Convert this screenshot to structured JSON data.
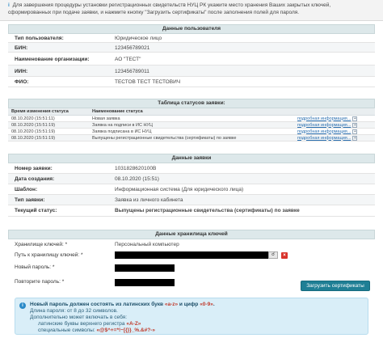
{
  "instruction": "Для завершения процедуры установки регистрационных свидетельств НУЦ РК укажите место хранения Ваших закрытых ключей, сформированных при подаче заявки, и нажмите кнопку \"Загрузить сертификаты\" после заполнения полей для пароля.",
  "user_data": {
    "header": "Данные пользователя",
    "rows": [
      {
        "label": "Тип пользователя:",
        "value": "Юридическое лицо"
      },
      {
        "label": "БИН:",
        "value": "123456789021"
      },
      {
        "label": "Наименование организации:",
        "value": "АО \"ТЕСТ\""
      },
      {
        "label": "ИИН:",
        "value": "123456789011"
      },
      {
        "label": "ФИО:",
        "value": "ТЕСТОВ ТЕСТ ТЕСТОВИЧ"
      }
    ]
  },
  "status_table": {
    "header": "Таблица статусов заявки:",
    "columns": [
      "Время изменения статуса",
      "Наименование статуса",
      ""
    ],
    "rows": [
      {
        "time": "08.10.2020 (15:51:11)",
        "status": "Новая заявка",
        "link": "подробная информация..."
      },
      {
        "time": "08.10.2020 (15:51:19)",
        "status": "Заявка на подписи в ИС НУЦ",
        "link": "подробная информация..."
      },
      {
        "time": "08.10.2020 (15:51:19)",
        "status": "Заявка подписана в ИС НУЦ",
        "link": "подробная информация..."
      },
      {
        "time": "08.10.2020 (15:51:19)",
        "status": "Выпущены регистрационные свидетельства (сертификаты) по заявке",
        "link": "подробная информация..."
      }
    ]
  },
  "request_data": {
    "header": "Данные заявки",
    "rows": [
      {
        "label": "Номер заявки:",
        "value": "1031828620100В"
      },
      {
        "label": "Дата создания:",
        "value": "08.10.2020 (15:51)"
      },
      {
        "label": "Шаблон:",
        "value": "Информационная система (Для юридического лица)"
      },
      {
        "label": "Тип заявки:",
        "value": "Заявка из личного кабинета"
      },
      {
        "label": "Текущий статус:",
        "value": "Выпущены регистрационные свидетельства (сертификаты) по заявке"
      }
    ]
  },
  "key_storage": {
    "header": "Данные хранилища ключей",
    "storage_label": "Хранилище ключей: *",
    "storage_value": "Персональный компьютер",
    "path_label": "Путь к хранилищу ключей: *",
    "new_password_label": "Новый пароль: *",
    "repeat_password_label": "Повторите пароль: *",
    "load_button": "Загрузить сертификаты",
    "search_icon": "search-icon",
    "clear_icon": "close-icon"
  },
  "info": {
    "line1_prefix": "Новый пароль должен состоять из латинских букв ",
    "line1_range1": "«a-z»",
    "line1_mid": " и цифр ",
    "line1_range2": "«0-9»",
    "line1_suffix": ".",
    "line2": "Длина пароля: от 8 до 32 символов.",
    "line3": "Дополнительно может включать в себя:",
    "line4_prefix": "латинские буквы верхнего регистра ",
    "line4_value": "«A-Z»",
    "line5_prefix": "специальные символы: ",
    "line5_value": "«@$^+=*!~[{}}_%.&#?-»"
  },
  "colors": {
    "accent": "#1f7f95",
    "status_green": "#1a7f2a",
    "info_bg": "#d9eef8",
    "header_bg": "#dde8ea"
  }
}
